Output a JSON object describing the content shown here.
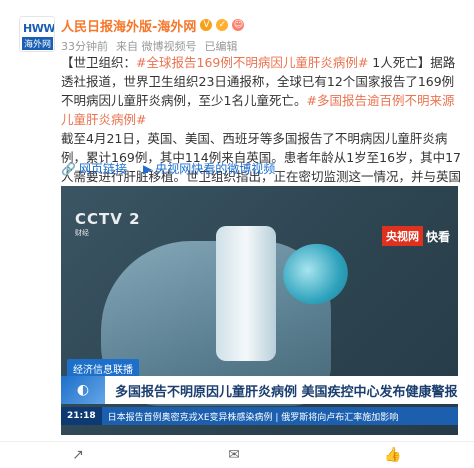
{
  "account": {
    "name": "人民日报海外版-海外网",
    "avatar_text_top": "HWW",
    "avatar_text_bottom": "海外网"
  },
  "meta": {
    "time": "33分钟前",
    "source": "来自 微博视频号",
    "status": "已编辑"
  },
  "post": {
    "p1_prefix": "【世卫组织：",
    "p1_tag1": "#全球报告169例不明病因儿童肝炎病例#",
    "p1_mid": " 1人死亡】据路透社报道，世界卫生组织23日通报称，全球已有12个国家报告了169例不明病因儿童肝炎病例，至少1名儿童死亡。",
    "p1_tag2": "#多国报告逾百例不明来源儿童肝炎病例#",
    "p2": "截至4月21日，英国、美国、西班牙等多国报告了不明病因儿童肝炎病例，累计169例，其中114例来自英国。患者年龄从1岁至16岁，其中17人需要进行肝脏移植。世卫组织指出，正在密切监测这一情况，并与英国卫生部门和其他成员国合作。"
  },
  "links": {
    "web_link": "网页链接",
    "video_link": "央视网快看的微博视频"
  },
  "video": {
    "channel_logo": "CCTV 2",
    "channel_sub": "财经",
    "watermark_red": "央视网",
    "watermark_text": "快看",
    "program_tag": "经济信息联播",
    "headline": "多国报告不明原因儿童肝炎病例 美国疾控中心发布健康警报",
    "ticker_time": "21:18",
    "ticker_text": "日本报告首例奥密克戎XE变异株感染病例 | 俄罗斯将向卢布汇率施加影响"
  },
  "actions": {
    "share": "↗",
    "comment": "✉",
    "like": "👍"
  }
}
